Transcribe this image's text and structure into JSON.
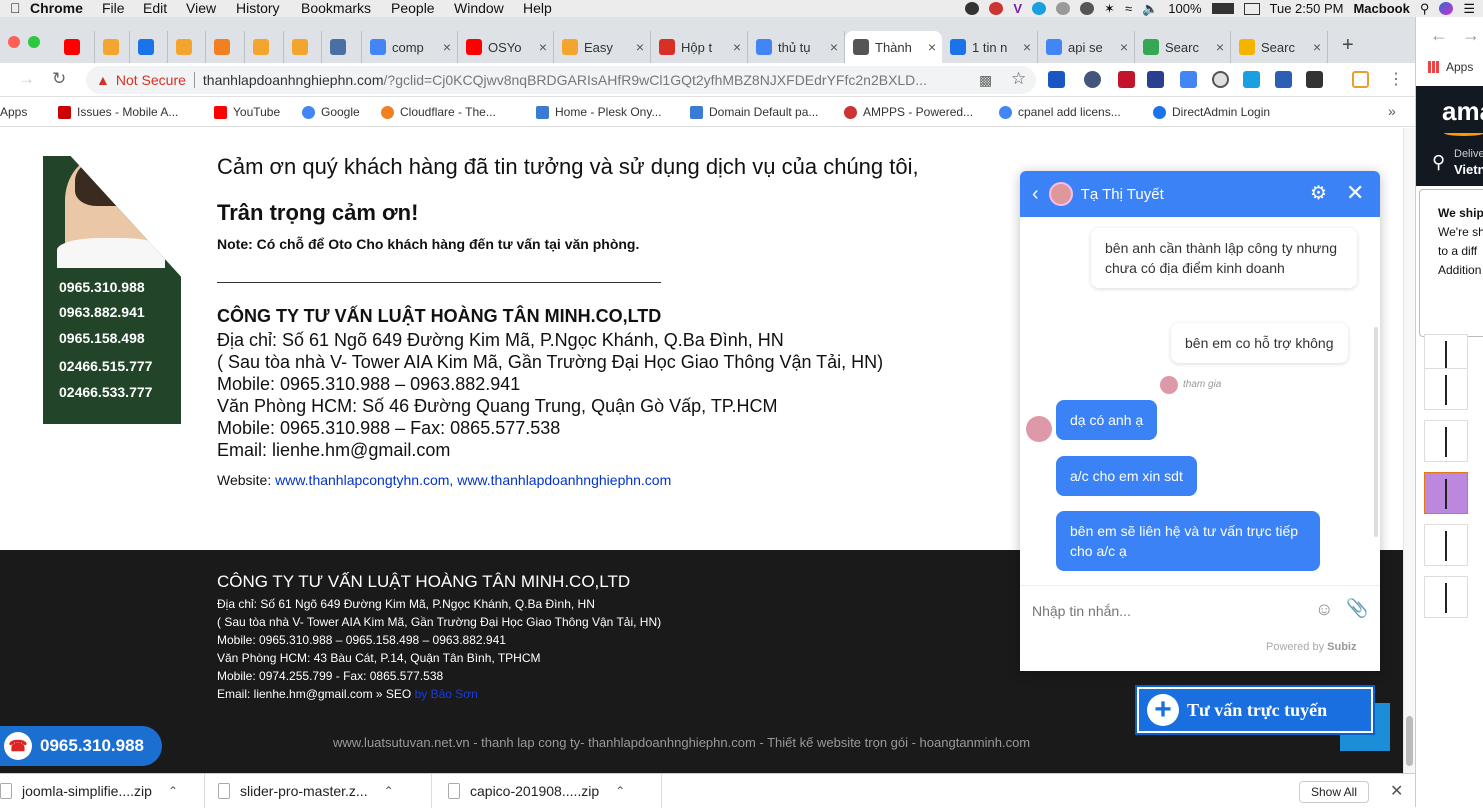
{
  "menubar": {
    "items": [
      "Chrome",
      "File",
      "Edit",
      "View",
      "History",
      "Bookmarks",
      "People",
      "Window",
      "Help"
    ],
    "battery": "100%",
    "clock": "Tue 2:50 PM",
    "user": "Macbook"
  },
  "tabs": [
    {
      "label": "",
      "favicon_color": "#ff0000"
    },
    {
      "label": "",
      "favicon_color": "#f4a52e"
    },
    {
      "label": "",
      "favicon_color": "#1a73e8"
    },
    {
      "label": "",
      "favicon_color": "#f4a52e"
    },
    {
      "label": "",
      "favicon_color": "#f38020"
    },
    {
      "label": "",
      "favicon_color": "#f4a52e"
    },
    {
      "label": "",
      "favicon_color": "#f4a52e"
    },
    {
      "label": "",
      "favicon_color": "#4a6fa5"
    },
    {
      "label": "comp",
      "favicon_color": "#4285f4"
    },
    {
      "label": "OSYo",
      "favicon_color": "#ff0000"
    },
    {
      "label": "Easy",
      "favicon_color": "#f4a52e"
    },
    {
      "label": "Hộp t",
      "favicon_color": "#d93025"
    },
    {
      "label": "thủ tụ",
      "favicon_color": "#4285f4"
    },
    {
      "label": "Thành",
      "favicon_color": "#555555",
      "active": true
    },
    {
      "label": "1 tin n",
      "favicon_color": "#1a73e8"
    },
    {
      "label": "api se",
      "favicon_color": "#4285f4"
    },
    {
      "label": "Searc",
      "favicon_color": "#34a853"
    },
    {
      "label": "Searc",
      "favicon_color": "#f4b400"
    }
  ],
  "omnibox": {
    "security_label": "Not Secure",
    "url_host": "thanhlapdoanhnghiephn.com",
    "url_rest": "/?gclid=Cj0KCQjwv8nqBRDGARIsAHfR9wCl1GQt2yfhMBZ8NJXFDEdrYFfc2n2BXLD..."
  },
  "bookmarks": [
    {
      "label": "Apps",
      "color": "#e44"
    },
    {
      "label": "Issues - Mobile A...",
      "color": "#c00"
    },
    {
      "label": "YouTube",
      "color": "#ff0000"
    },
    {
      "label": "Google",
      "color": "#4285f4"
    },
    {
      "label": "Cloudflare - The...",
      "color": "#f38020"
    },
    {
      "label": "Home - Plesk Ony...",
      "color": "#3a7bd5"
    },
    {
      "label": "Domain Default pa...",
      "color": "#3a7bd5"
    },
    {
      "label": "AMPPS - Powered...",
      "color": "#c33"
    },
    {
      "label": "cpanel add licens...",
      "color": "#4285f4"
    },
    {
      "label": "DirectAdmin Login",
      "color": "#1a73e8"
    }
  ],
  "hotline": [
    "0965.310.988",
    "0963.882.941",
    "0965.158.498",
    "02466.515.777",
    "02466.533.777"
  ],
  "content": {
    "thanks": "Cảm ơn quý khách hàng đã tin tưởng và sử dụng dịch vụ của chúng tôi,",
    "regards": "Trân trọng cảm ơn!",
    "note": "Note: Có chỗ để Oto Cho khách hàng đến tư vấn tại văn phòng.",
    "company": "CÔNG TY TƯ VẤN LUẬT HOÀNG TÂN MINH.CO,LTD",
    "address_lines": [
      "Địa chỉ: Số 61 Ngõ 649 Đường Kim Mã, P.Ngọc Khánh, Q.Ba Đình, HN",
      "( Sau tòa nhà V- Tower AIA Kim Mã, Gần Trường Đại Học Giao Thông Vận Tải, HN)",
      "Mobile: 0965.310.988 –  0963.882.941",
      "Văn Phòng HCM: Số 46 Đường Quang Trung, Quận Gò Vấp, TP.HCM",
      "Mobile: 0965.310.988 – Fax: 0865.577.538",
      "Email: lienhe.hm@gmail.com"
    ],
    "website_label": "Website: ",
    "website_links": "www.thanhlapcongtyhn.com, www.thanhlapdoanhnghiephn.com"
  },
  "footer": {
    "title": "CÔNG TY TƯ VẤN LUẬT HOÀNG TÂN MINH.CO,LTD",
    "lines": [
      "Địa chỉ: Số 61 Ngõ 649 Đường Kim Mã, P.Ngọc Khánh, Q.Ba Đình, HN",
      "( Sau tòa nhà V- Tower AIA Kim Mã, Gần Trường Đại Học Giao Thông Vận Tải, HN)",
      "Mobile: 0965.310.988 – 0965.158.498 – 0963.882.941",
      "Văn Phòng HCM: 43 Bàu Cát, P.14, Quận Tân Bình, TPHCM",
      "Mobile: 0974.255.799 - Fax: 0865.577.538"
    ],
    "email_line": "Email: lienhe.hm@gmail.com » SEO ",
    "seo_link": "by Bảo Sơn",
    "bottom_links": "www.luatsutuvan.net.vn - thanh lap cong ty- thanhlapdoanhnghiephn.com - Thiết kế website trọn gói - hoangtanminh.com",
    "phone_pill": "0965.310.988"
  },
  "consult_button": "Tư vấn trực tuyến",
  "chat": {
    "agent_name": "Tạ Thị Tuyết",
    "messages": [
      {
        "side": "in",
        "text": "bên anh cần thành lập công ty nhưng chưa có địa điểm kinh doanh"
      },
      {
        "side": "in",
        "text": "bên em co hỗ trợ không"
      },
      {
        "side": "out",
        "text": "dạ có anh ạ"
      },
      {
        "side": "out",
        "text": "a/c cho em xin sdt"
      },
      {
        "side": "out",
        "text": "bên em sẽ liên hệ và tư vấn trực tiếp cho a/c ạ"
      }
    ],
    "joined_label": "tham gia",
    "input_placeholder": "Nhập tin nhắn...",
    "powered_prefix": "Powered by ",
    "powered_brand": "Subiz"
  },
  "side_panel": {
    "apps_label": "Apps",
    "logo": "ama",
    "deliver": "Delive",
    "location": "Vietn",
    "popup_title": "We ship",
    "popup_lines": [
      "We're sh",
      "to a diff",
      "Addition"
    ]
  },
  "downloads": [
    {
      "name": "joomla-simplifie....zip"
    },
    {
      "name": "slider-pro-master.z..."
    },
    {
      "name": "capico-201908.....zip"
    }
  ],
  "show_all": "Show All"
}
